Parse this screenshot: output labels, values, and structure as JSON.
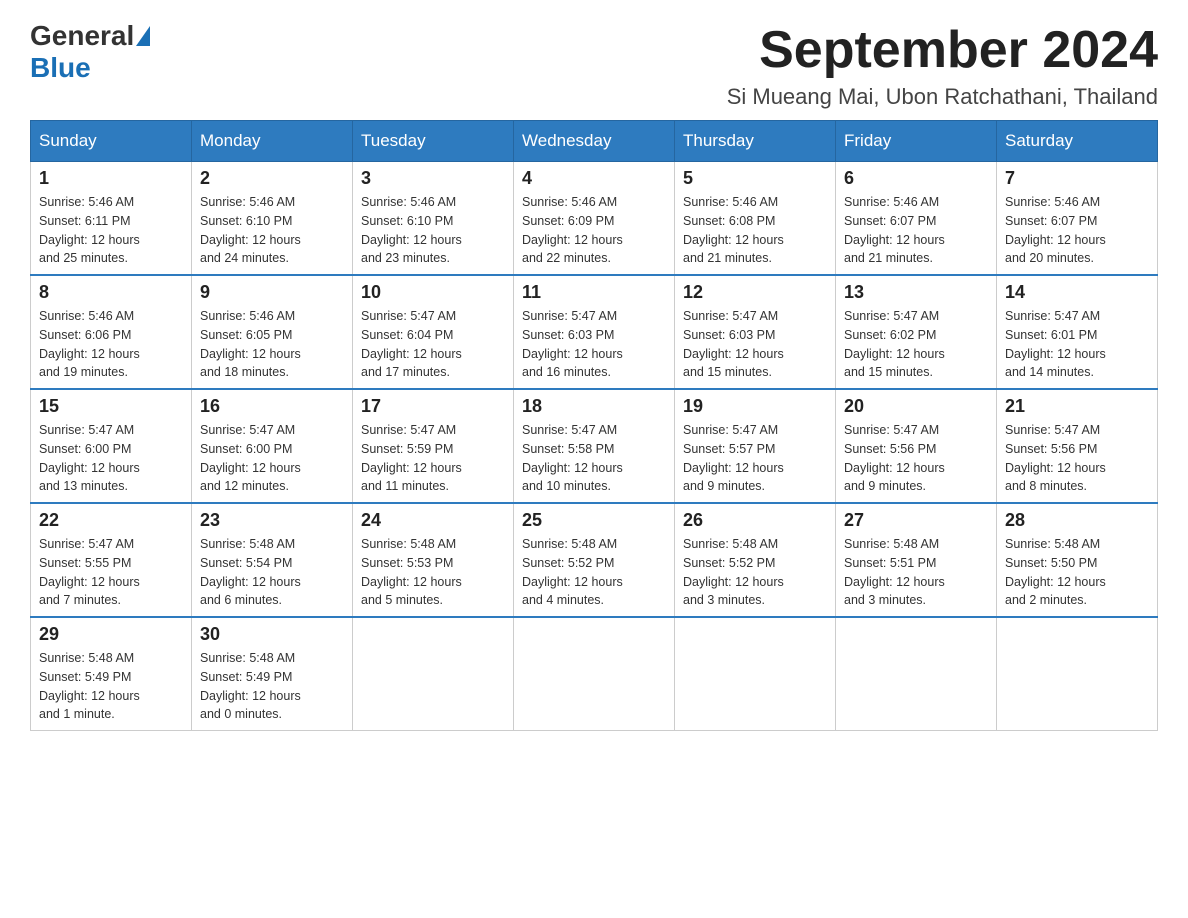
{
  "header": {
    "logo_general": "General",
    "logo_blue": "Blue",
    "month_title": "September 2024",
    "location": "Si Mueang Mai, Ubon Ratchathani, Thailand"
  },
  "days_of_week": [
    "Sunday",
    "Monday",
    "Tuesday",
    "Wednesday",
    "Thursday",
    "Friday",
    "Saturday"
  ],
  "weeks": [
    [
      {
        "day": "1",
        "sunrise": "5:46 AM",
        "sunset": "6:11 PM",
        "daylight": "12 hours and 25 minutes."
      },
      {
        "day": "2",
        "sunrise": "5:46 AM",
        "sunset": "6:10 PM",
        "daylight": "12 hours and 24 minutes."
      },
      {
        "day": "3",
        "sunrise": "5:46 AM",
        "sunset": "6:10 PM",
        "daylight": "12 hours and 23 minutes."
      },
      {
        "day": "4",
        "sunrise": "5:46 AM",
        "sunset": "6:09 PM",
        "daylight": "12 hours and 22 minutes."
      },
      {
        "day": "5",
        "sunrise": "5:46 AM",
        "sunset": "6:08 PM",
        "daylight": "12 hours and 21 minutes."
      },
      {
        "day": "6",
        "sunrise": "5:46 AM",
        "sunset": "6:07 PM",
        "daylight": "12 hours and 21 minutes."
      },
      {
        "day": "7",
        "sunrise": "5:46 AM",
        "sunset": "6:07 PM",
        "daylight": "12 hours and 20 minutes."
      }
    ],
    [
      {
        "day": "8",
        "sunrise": "5:46 AM",
        "sunset": "6:06 PM",
        "daylight": "12 hours and 19 minutes."
      },
      {
        "day": "9",
        "sunrise": "5:46 AM",
        "sunset": "6:05 PM",
        "daylight": "12 hours and 18 minutes."
      },
      {
        "day": "10",
        "sunrise": "5:47 AM",
        "sunset": "6:04 PM",
        "daylight": "12 hours and 17 minutes."
      },
      {
        "day": "11",
        "sunrise": "5:47 AM",
        "sunset": "6:03 PM",
        "daylight": "12 hours and 16 minutes."
      },
      {
        "day": "12",
        "sunrise": "5:47 AM",
        "sunset": "6:03 PM",
        "daylight": "12 hours and 15 minutes."
      },
      {
        "day": "13",
        "sunrise": "5:47 AM",
        "sunset": "6:02 PM",
        "daylight": "12 hours and 15 minutes."
      },
      {
        "day": "14",
        "sunrise": "5:47 AM",
        "sunset": "6:01 PM",
        "daylight": "12 hours and 14 minutes."
      }
    ],
    [
      {
        "day": "15",
        "sunrise": "5:47 AM",
        "sunset": "6:00 PM",
        "daylight": "12 hours and 13 minutes."
      },
      {
        "day": "16",
        "sunrise": "5:47 AM",
        "sunset": "6:00 PM",
        "daylight": "12 hours and 12 minutes."
      },
      {
        "day": "17",
        "sunrise": "5:47 AM",
        "sunset": "5:59 PM",
        "daylight": "12 hours and 11 minutes."
      },
      {
        "day": "18",
        "sunrise": "5:47 AM",
        "sunset": "5:58 PM",
        "daylight": "12 hours and 10 minutes."
      },
      {
        "day": "19",
        "sunrise": "5:47 AM",
        "sunset": "5:57 PM",
        "daylight": "12 hours and 9 minutes."
      },
      {
        "day": "20",
        "sunrise": "5:47 AM",
        "sunset": "5:56 PM",
        "daylight": "12 hours and 9 minutes."
      },
      {
        "day": "21",
        "sunrise": "5:47 AM",
        "sunset": "5:56 PM",
        "daylight": "12 hours and 8 minutes."
      }
    ],
    [
      {
        "day": "22",
        "sunrise": "5:47 AM",
        "sunset": "5:55 PM",
        "daylight": "12 hours and 7 minutes."
      },
      {
        "day": "23",
        "sunrise": "5:48 AM",
        "sunset": "5:54 PM",
        "daylight": "12 hours and 6 minutes."
      },
      {
        "day": "24",
        "sunrise": "5:48 AM",
        "sunset": "5:53 PM",
        "daylight": "12 hours and 5 minutes."
      },
      {
        "day": "25",
        "sunrise": "5:48 AM",
        "sunset": "5:52 PM",
        "daylight": "12 hours and 4 minutes."
      },
      {
        "day": "26",
        "sunrise": "5:48 AM",
        "sunset": "5:52 PM",
        "daylight": "12 hours and 3 minutes."
      },
      {
        "day": "27",
        "sunrise": "5:48 AM",
        "sunset": "5:51 PM",
        "daylight": "12 hours and 3 minutes."
      },
      {
        "day": "28",
        "sunrise": "5:48 AM",
        "sunset": "5:50 PM",
        "daylight": "12 hours and 2 minutes."
      }
    ],
    [
      {
        "day": "29",
        "sunrise": "5:48 AM",
        "sunset": "5:49 PM",
        "daylight": "12 hours and 1 minute."
      },
      {
        "day": "30",
        "sunrise": "5:48 AM",
        "sunset": "5:49 PM",
        "daylight": "12 hours and 0 minutes."
      },
      null,
      null,
      null,
      null,
      null
    ]
  ],
  "labels": {
    "sunrise": "Sunrise:",
    "sunset": "Sunset:",
    "daylight": "Daylight:"
  }
}
